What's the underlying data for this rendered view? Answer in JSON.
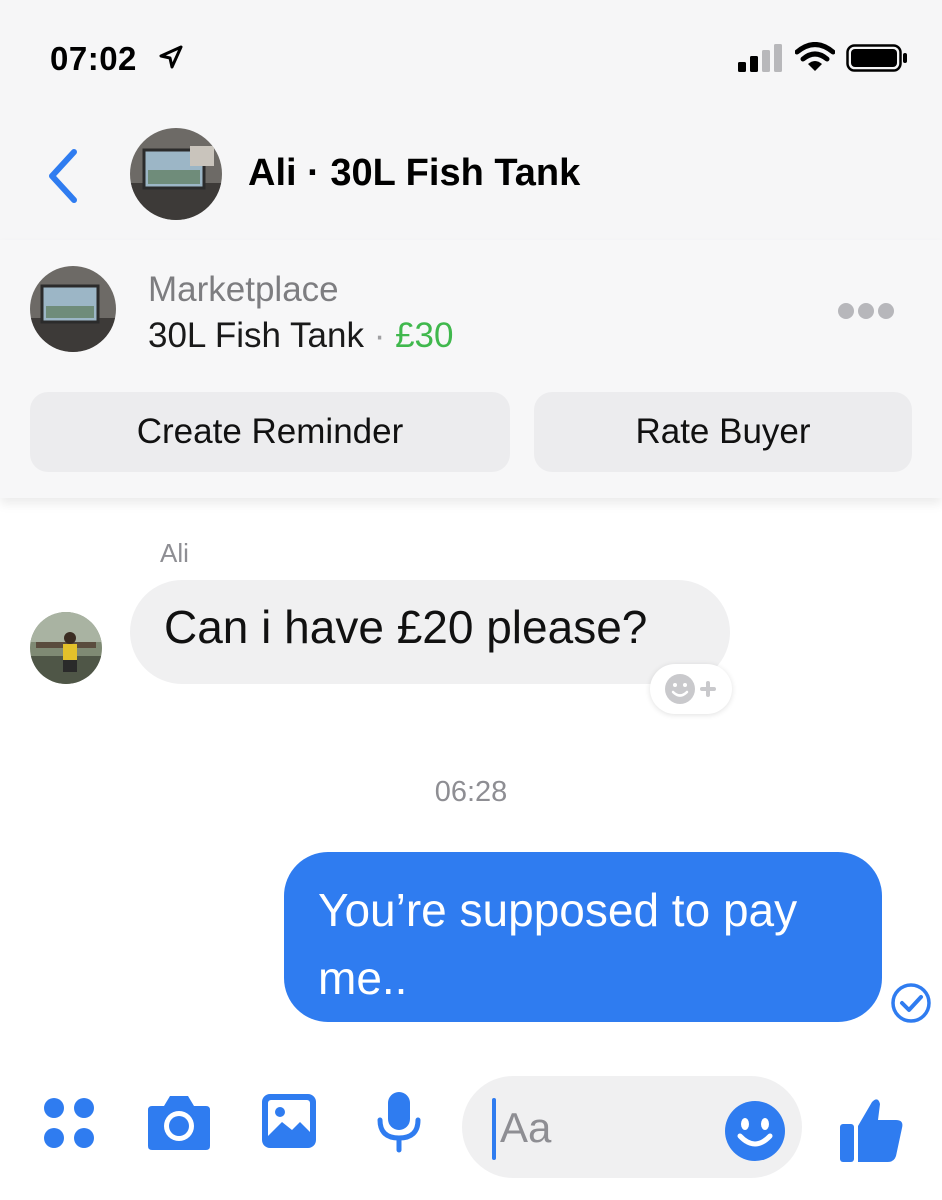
{
  "status_bar": {
    "time": "07:02",
    "icons": [
      "location-arrow-icon",
      "signal-bars-icon",
      "wifi-icon",
      "battery-icon"
    ]
  },
  "header": {
    "back_icon": "chevron-left-icon",
    "title": "Ali · 30L Fish Tank"
  },
  "marketplace": {
    "label": "Marketplace",
    "item": "30L Fish Tank",
    "separator": "·",
    "price": "£30",
    "more_icon": "more-dots-icon",
    "buttons": {
      "create_reminder": "Create Reminder",
      "rate_buyer": "Rate Buyer"
    }
  },
  "messages": {
    "incoming": {
      "sender": "Ali",
      "text": "Can i have £20 please?"
    },
    "timestamp": "06:28",
    "outgoing": {
      "text": "You’re supposed to pay me.."
    }
  },
  "composer": {
    "placeholder": "Aa",
    "icons": [
      "menu-dots-icon",
      "camera-icon",
      "photo-icon",
      "microphone-icon",
      "emoji-icon",
      "thumbs-up-icon"
    ]
  },
  "colors": {
    "accent": "#2f7cf0",
    "price_green": "#40b84d",
    "bubble_incoming": "#f0f0f1",
    "header_bg": "#f6f6f7"
  }
}
